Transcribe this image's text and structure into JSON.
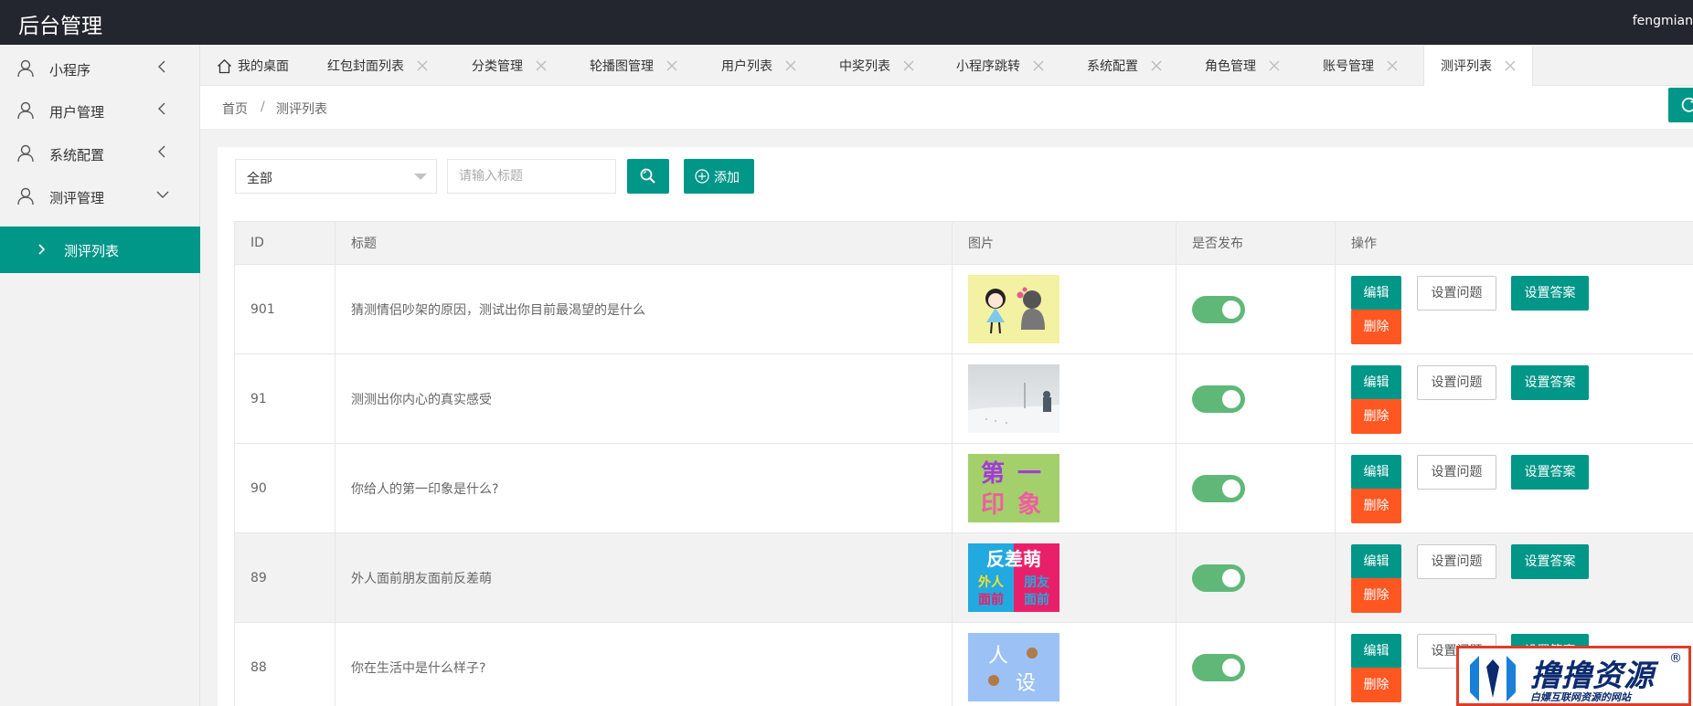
{
  "header": {
    "title": "后台管理",
    "username": "fengmian"
  },
  "sidebar": {
    "items": [
      {
        "label": "小程序",
        "icon": "user-icon",
        "expanded": false
      },
      {
        "label": "用户管理",
        "icon": "user-icon",
        "expanded": false
      },
      {
        "label": "系统配置",
        "icon": "user-icon",
        "expanded": false
      },
      {
        "label": "测评管理",
        "icon": "user-icon",
        "expanded": true
      }
    ],
    "subitems": [
      {
        "label": "测评列表",
        "active": true
      }
    ]
  },
  "tabs": [
    {
      "label": "我的桌面",
      "icon": "home-icon",
      "closable": false
    },
    {
      "label": "红包封面列表",
      "closable": true
    },
    {
      "label": "分类管理",
      "closable": true
    },
    {
      "label": "轮播图管理",
      "closable": true
    },
    {
      "label": "用户列表",
      "closable": true
    },
    {
      "label": "中奖列表",
      "closable": true
    },
    {
      "label": "小程序跳转",
      "closable": true
    },
    {
      "label": "系统配置",
      "closable": true
    },
    {
      "label": "角色管理",
      "closable": true
    },
    {
      "label": "账号管理",
      "closable": true
    },
    {
      "label": "测评列表",
      "closable": true,
      "active": true
    }
  ],
  "breadcrumb": {
    "home": "首页",
    "separator": "/",
    "current": "测评列表"
  },
  "filter": {
    "category_value": "全部",
    "search_placeholder": "请输入标题",
    "add_label": "添加"
  },
  "table": {
    "columns": [
      "ID",
      "标题",
      "图片",
      "是否发布",
      "操作"
    ],
    "rows": [
      {
        "id": "901",
        "title": "猜测情侣吵架的原因，测试出你目前最渴望的是什么",
        "image": "couple-illustration",
        "published": true
      },
      {
        "id": "91",
        "title": "测测出你内心的真实感受",
        "image": "snow-scene",
        "published": true
      },
      {
        "id": "90",
        "title": "你给人的第一印象是什么?",
        "image_text": [
          "第",
          "一",
          "印",
          "象"
        ],
        "published": true
      },
      {
        "id": "89",
        "title": "外人面前朋友面前反差萌",
        "image_text": [
          "反差萌",
          "外人",
          "面前",
          "朋友",
          "面前"
        ],
        "published": true,
        "highlighted": true
      },
      {
        "id": "88",
        "title": "你在生活中是什么样子?",
        "image_text": [
          "人",
          "设"
        ],
        "published": true
      }
    ],
    "actions": {
      "edit": "编辑",
      "set_questions": "设置问题",
      "set_answers": "设置答案",
      "delete": "删除"
    }
  },
  "watermark": {
    "title": "撸撸资源",
    "registered": "®",
    "subtitle": "白嫖互联网资源的网站"
  },
  "colors": {
    "primary": "#009688",
    "danger": "#ff5722",
    "switch_on": "#5fb878",
    "header_bg": "#23262e"
  }
}
